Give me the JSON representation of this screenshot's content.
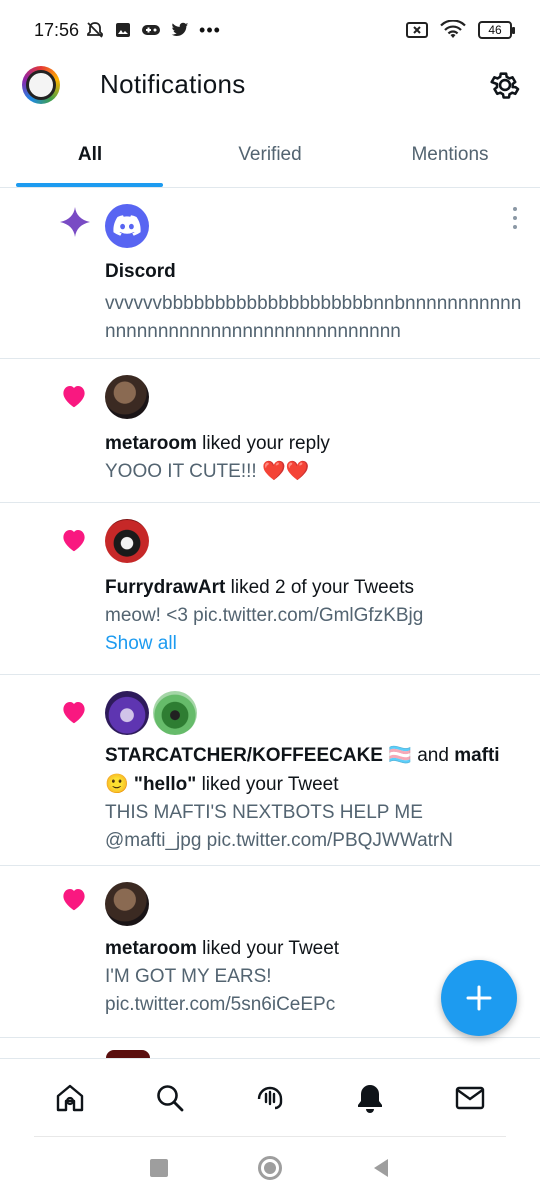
{
  "status_bar": {
    "time": "17:56",
    "battery": "46",
    "left_icons": [
      "mute-icon",
      "image-icon",
      "gamepad-icon",
      "twitter-icon",
      "more-dots"
    ],
    "right_icons": [
      "sim-off-icon",
      "wifi-icon",
      "battery-icon"
    ]
  },
  "header": {
    "title": "Notifications"
  },
  "tabs": [
    {
      "label": "All",
      "active": true
    },
    {
      "label": "Verified",
      "active": false
    },
    {
      "label": "Mentions",
      "active": false
    }
  ],
  "notifications": [
    {
      "type": "sparkle",
      "name": "Discord",
      "action": "",
      "snippet": "vvvvvvbbbbbbbbbbbbbbbbbbbbnnbnnnnnnnnnnnnnnnnnnnnnnnnnnnnnnnnnnnnnnn"
    },
    {
      "type": "like",
      "name": "metaroom",
      "action": " liked your reply",
      "snippet": "YOOO IT CUTE!!! ❤️❤️"
    },
    {
      "type": "like",
      "name": "FurrydrawArt",
      "action": " liked 2 of your Tweets",
      "snippet": "meow! <3 pic.twitter.com/GmlGfzKBjg",
      "show_all": "Show all"
    },
    {
      "type": "like",
      "name": "STARCATCHER/KOFFEECAKE",
      "flag": "🏳️‍⚧️",
      "connector": " and ",
      "name2": "mafti",
      "name2_suffix": "🙂 \"hello\"",
      "action": " liked your Tweet",
      "snippet": "THIS MAFTI'S NEXTBOTS HELP ME @mafti_jpg pic.twitter.com/PBQJWWatrN"
    },
    {
      "type": "like",
      "name": "metaroom",
      "action": " liked your Tweet",
      "snippet": "I'M GOT MY EARS! pic.twitter.com/5sn6iCeEPc"
    }
  ],
  "bottom_nav": [
    "home-icon",
    "search-icon",
    "spaces-icon",
    "notifications-icon",
    "messages-icon"
  ],
  "colors": {
    "accent": "#1d9bf0",
    "like": "#f91880",
    "sparkle": "#794bc4",
    "discord": "#5865f2"
  }
}
